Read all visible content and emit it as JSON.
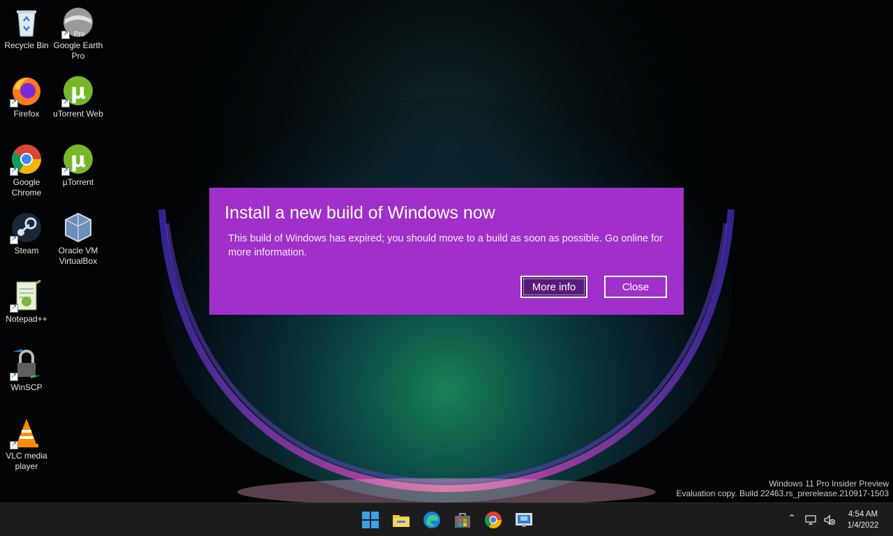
{
  "desktop": {
    "icons": [
      {
        "label": "Recycle Bin",
        "icon": "recycle-bin-icon"
      },
      {
        "label": "Google Earth Pro",
        "icon": "google-earth-icon",
        "badge": "Pro"
      },
      {
        "label": "Firefox",
        "icon": "firefox-icon"
      },
      {
        "label": "uTorrent Web",
        "icon": "utorrent-web-icon"
      },
      {
        "label": "Google Chrome",
        "icon": "chrome-icon"
      },
      {
        "label": "µTorrent",
        "icon": "utorrent-icon"
      },
      {
        "label": "Steam",
        "icon": "steam-icon"
      },
      {
        "label": "Oracle VM VirtualBox",
        "icon": "virtualbox-icon"
      },
      {
        "label": "Notepad++",
        "icon": "notepad-plus-plus-icon"
      },
      {
        "label": "WinSCP",
        "icon": "winscp-icon"
      },
      {
        "label": "VLC media player",
        "icon": "vlc-icon"
      }
    ]
  },
  "dialog": {
    "title": "Install a new build of Windows now",
    "body": "This build of Windows has expired; you should move to a build as soon as possible. Go online for more information.",
    "more_info_label": "More info",
    "close_label": "Close",
    "accent_color": "#a030c9"
  },
  "watermark": {
    "line1": "Windows 11 Pro Insider Preview",
    "line2": "Evaluation copy. Build 22463.rs_prerelease.210917-1503"
  },
  "taskbar": {
    "apps": [
      "start-icon",
      "file-explorer-icon",
      "edge-icon",
      "microsoft-store-icon",
      "chrome-icon",
      "remote-desktop-icon"
    ],
    "tray": [
      "chevron-up-icon",
      "network-icon",
      "volume-muted-icon"
    ],
    "time": "4:54 AM",
    "date": "1/4/2022"
  }
}
